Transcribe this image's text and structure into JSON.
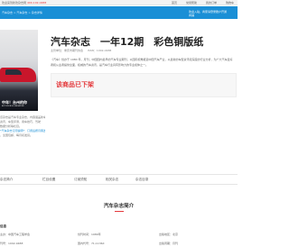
{
  "topbar": {
    "welcome": "欢迎来到新欢杂志网",
    "phone": "400-102-0488",
    "links": [
      "首页",
      "常用帮助",
      "我的订单",
      "购物车"
    ]
  },
  "nav": {
    "breadcrumb": "汽车杂志 > 汽车杂志 > 杂志详情",
    "login": "欢迎入驻，商家请登录账户开通商铺"
  },
  "cover": {
    "headline": "中年！台州的你",
    "sub": "AUTOMOBILE MAGAZINE"
  },
  "product": {
    "title": "汽车杂志　一年12期　彩色铜版纸",
    "publisher": "主管单位：重庆市期刊协会",
    "issn": "ISSN：1002-0488",
    "desc": "《汽车》创办于 1980 年，月刊，中国国内最早的汽车专业期刊，以国际视角报道中国汽车产业，以最新的车型资讯和深度的行业分析，为广大汽车爱好者和从业者提供全面、权威的汽车资讯，是汽车行业具有影响力的专业媒体之一。",
    "status": "该商品已下架"
  },
  "left_info": [
    "该杂志是汽车专业杂志，内容涵盖新车",
    "资讯、车型评测、用车技巧、驾驶",
    "数据分析等栏目。",
    "*汽车杂志订阅说明*：订阅后按月寄送",
    "，全国包邮，每月初发货。"
  ],
  "tabs": [
    "杂志简介",
    "栏目设置",
    "订阅须知",
    "相关杂志",
    "杂志目录"
  ],
  "section": {
    "title": "汽车杂志简介"
  },
  "info": {
    "label": "信息",
    "rows": [
      {
        "a": "主办：中国汽车工程学会",
        "b": "创刊时间：1980年",
        "c": "出版地区：北京"
      },
      {
        "a": "刊号：1002-0488",
        "b": "国内代号：71-1136X",
        "c": "出版周期：月刊"
      }
    ]
  },
  "colors": {
    "brand": "#1a8fd6",
    "accent": "#e4393c"
  }
}
